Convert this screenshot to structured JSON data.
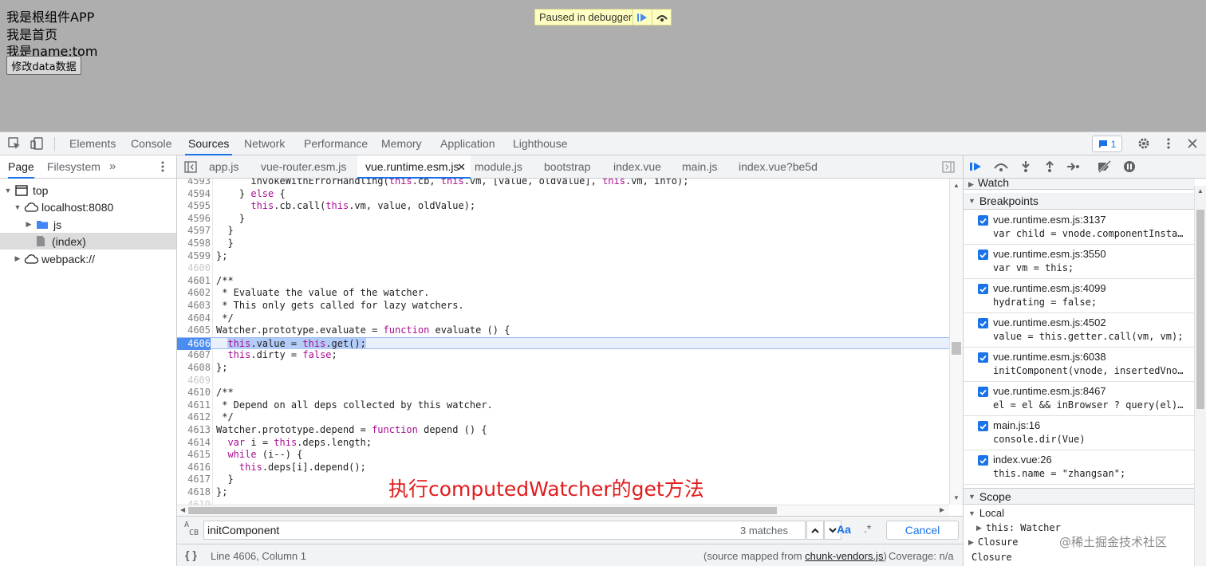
{
  "page": {
    "lines": [
      "我是根组件APP",
      "我是首页",
      "我是name:tom"
    ],
    "button": "修改data数据",
    "paused_label": "Paused in debugger"
  },
  "devtools": {
    "tabs": [
      "Elements",
      "Console",
      "Sources",
      "Network",
      "Performance",
      "Memory",
      "Application",
      "Lighthouse"
    ],
    "active_tab": "Sources",
    "message_count": "1"
  },
  "navigator": {
    "tabs": [
      "Page",
      "Filesystem"
    ],
    "tree": [
      {
        "label": "top",
        "icon": "frame-icon",
        "expanded": true
      },
      {
        "label": "localhost:8080",
        "icon": "cloud-icon",
        "expanded": true
      },
      {
        "label": "js",
        "icon": "folder-icon",
        "expanded": false
      },
      {
        "label": "(index)",
        "icon": "file-icon",
        "selected": true
      },
      {
        "label": "webpack://",
        "icon": "cloud-icon",
        "expanded": false
      }
    ]
  },
  "editor": {
    "file_tabs": [
      "app.js",
      "vue-router.esm.js",
      "vue.runtime.esm.js",
      "module.js",
      "bootstrap",
      "index.vue",
      "main.js",
      "index.vue?be5d"
    ],
    "active_file": "vue.runtime.esm.js",
    "lines": [
      {
        "n": "4593",
        "t": "      invokeWithErrorHandling(this.cb, this.vm, [value, oldValue], this.vm, info);"
      },
      {
        "n": "4594",
        "t": "    } else {"
      },
      {
        "n": "4595",
        "t": "      this.cb.call(this.vm, value, oldValue);"
      },
      {
        "n": "4596",
        "t": "    }"
      },
      {
        "n": "4597",
        "t": "  }"
      },
      {
        "n": "4598",
        "t": "  }"
      },
      {
        "n": "4599",
        "t": "};"
      },
      {
        "n": "4600",
        "t": ""
      },
      {
        "n": "4601",
        "t": "/**"
      },
      {
        "n": "4602",
        "t": " * Evaluate the value of the watcher."
      },
      {
        "n": "4603",
        "t": " * This only gets called for lazy watchers."
      },
      {
        "n": "4604",
        "t": " */"
      },
      {
        "n": "4605",
        "t": "Watcher.prototype.evaluate = function evaluate () {"
      },
      {
        "n": "4606",
        "t": "  this.value = this.get();"
      },
      {
        "n": "4607",
        "t": "  this.dirty = false;"
      },
      {
        "n": "4608",
        "t": "};"
      },
      {
        "n": "4609",
        "t": ""
      },
      {
        "n": "4610",
        "t": "/**"
      },
      {
        "n": "4611",
        "t": " * Depend on all deps collected by this watcher."
      },
      {
        "n": "4612",
        "t": " */"
      },
      {
        "n": "4613",
        "t": "Watcher.prototype.depend = function depend () {"
      },
      {
        "n": "4614",
        "t": "  var i = this.deps.length;"
      },
      {
        "n": "4615",
        "t": "  while (i--) {"
      },
      {
        "n": "4616",
        "t": "    this.deps[i].depend();"
      },
      {
        "n": "4617",
        "t": "  }"
      },
      {
        "n": "4618",
        "t": "};"
      },
      {
        "n": "4619",
        "t": ""
      }
    ],
    "annotation": "执行computedWatcher的get方法",
    "find": {
      "value": "initComponent",
      "matches": "3 matches",
      "case_label": "Aa",
      "regex_label": ".*",
      "cancel": "Cancel"
    },
    "status": {
      "position": "Line 4606, Column 1",
      "mapped_prefix": "(source mapped from ",
      "mapped_link": "chunk-vendors.js",
      "mapped_suffix": ")",
      "coverage": "Coverage: n/a"
    }
  },
  "sidebar": {
    "watch_label": "Watch",
    "breakpoints_label": "Breakpoints",
    "breakpoints": [
      {
        "loc": "vue.runtime.esm.js:3137",
        "code": "var child = vnode.componentInsta…"
      },
      {
        "loc": "vue.runtime.esm.js:3550",
        "code": "var vm = this;"
      },
      {
        "loc": "vue.runtime.esm.js:4099",
        "code": "hydrating = false;"
      },
      {
        "loc": "vue.runtime.esm.js:4502",
        "code": "value = this.getter.call(vm, vm);"
      },
      {
        "loc": "vue.runtime.esm.js:6038",
        "code": "initComponent(vnode, insertedVno…"
      },
      {
        "loc": "vue.runtime.esm.js:8467",
        "code": "el = el && inBrowser ? query(el)…"
      },
      {
        "loc": "main.js:16",
        "code": "console.dir(Vue)"
      },
      {
        "loc": "index.vue:26",
        "code": "this.name = \"zhangsan\";"
      }
    ],
    "scope_label": "Scope",
    "local_label": "Local",
    "this_value": "this: Watcher",
    "closure_label": "Closure",
    "closure2_label": "Closure"
  },
  "watermark": "@稀土掘金技术社区",
  "colors": {
    "accent": "#1a73e8",
    "annotation": "#e01c1c",
    "page_bg": "#aeaeae"
  }
}
